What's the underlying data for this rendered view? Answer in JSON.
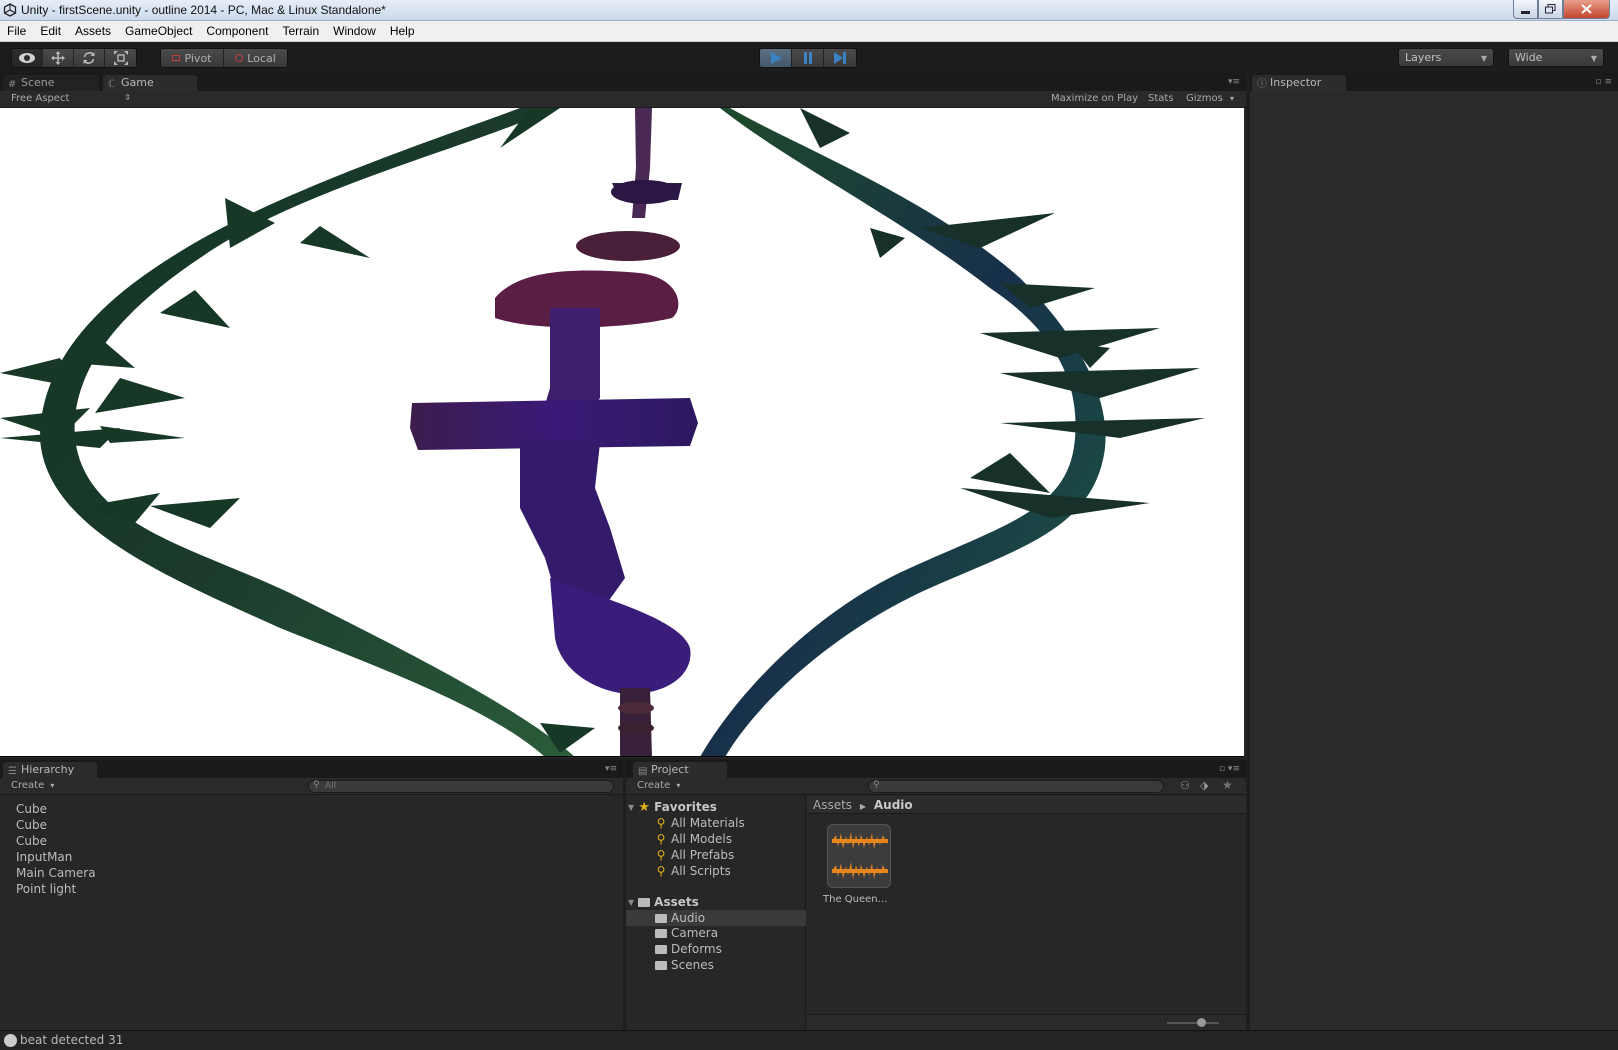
{
  "window": {
    "title": "Unity - firstScene.unity - outline 2014 - PC, Mac & Linux Standalone*"
  },
  "menu": [
    "File",
    "Edit",
    "Assets",
    "GameObject",
    "Component",
    "Terrain",
    "Window",
    "Help"
  ],
  "toolbar": {
    "pivot_label": "Pivot",
    "local_label": "Local",
    "layers_label": "Layers",
    "layout_label": "Wide"
  },
  "scene_panel": {
    "tabs": [
      "Scene",
      "Game"
    ],
    "aspect_label": "Free Aspect",
    "maximize_label": "Maximize on Play",
    "stats_label": "Stats",
    "gizmos_label": "Gizmos"
  },
  "inspector": {
    "tab_label": "Inspector"
  },
  "hierarchy": {
    "tab_label": "Hierarchy",
    "create_label": "Create",
    "search_placeholder": "All",
    "items": [
      "Cube",
      "Cube",
      "Cube",
      "InputMan",
      "Main Camera",
      "Point light"
    ]
  },
  "project": {
    "tab_label": "Project",
    "create_label": "Create",
    "favorites_label": "Favorites",
    "favorites": [
      "All Materials",
      "All Models",
      "All Prefabs",
      "All Scripts"
    ],
    "assets_label": "Assets",
    "folders": [
      "Audio",
      "Camera",
      "Deforms",
      "Scenes"
    ],
    "breadcrumb_root": "Assets",
    "breadcrumb_current": "Audio",
    "asset_label": "The Queen…"
  },
  "status": {
    "message": "beat detected 31"
  },
  "colors": {
    "accent": "#3b82c4",
    "play_active": "#4a5d71",
    "folder_star": "#e0b21a",
    "audio_orange": "#e8861e"
  }
}
